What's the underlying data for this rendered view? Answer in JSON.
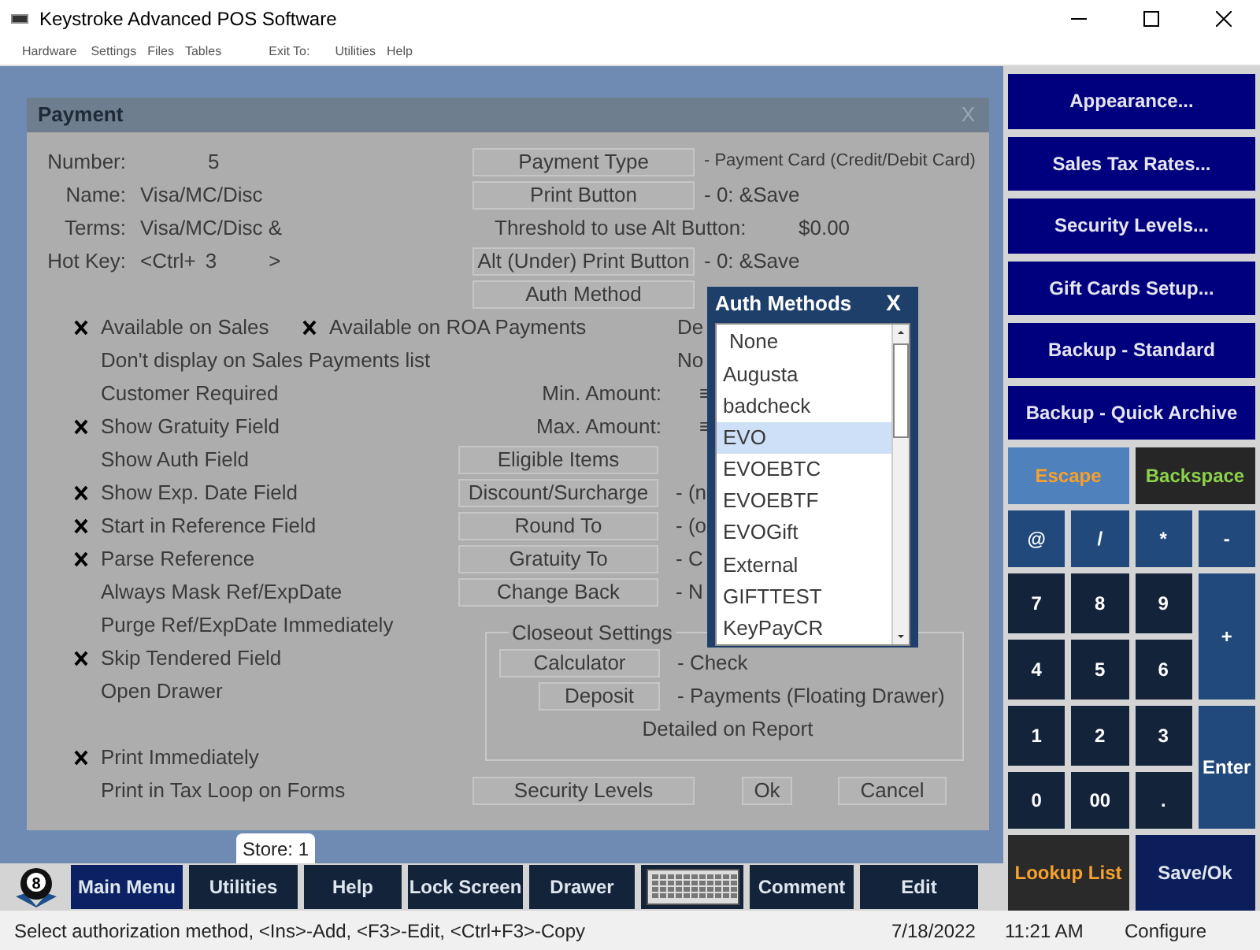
{
  "window": {
    "title": "Keystroke Advanced POS Software"
  },
  "menu": [
    {
      "label": "Hardware"
    },
    {
      "label": "Settings"
    },
    {
      "label": "Files"
    },
    {
      "label": "Tables"
    },
    {
      "label": "Exit To:"
    },
    {
      "label": "Utilities"
    },
    {
      "label": "Help"
    }
  ],
  "dialog": {
    "title": "Payment",
    "close": "X",
    "fields": [
      {
        "label": "Number:",
        "value": "5"
      },
      {
        "label": "Name:",
        "value": "Visa/MC/Disc"
      },
      {
        "label": "Terms:",
        "value": "Visa/MC/Disc &"
      },
      {
        "label": "Hot Key:",
        "value": "<Ctrl+",
        "key": "3",
        "suffix": ">"
      }
    ],
    "top_buttons": [
      {
        "button": "Payment Type",
        "value": "- Payment Card (Credit/Debit Card)"
      },
      {
        "button": "Print Button",
        "value": "- 0: &Save"
      },
      {
        "label": "Threshold to use Alt Button:",
        "value": "$0.00"
      },
      {
        "button": "Alt (Under) Print Button",
        "value": "- 0: &Save"
      },
      {
        "button": "Auth Method"
      }
    ],
    "options": [
      {
        "label": "Available on Sales",
        "checked": true
      },
      {
        "label": "Don't display on Sales Payments list",
        "checked": false
      },
      {
        "label": "Customer Required",
        "checked": false
      },
      {
        "label": "Show Gratuity Field",
        "checked": true
      },
      {
        "label": "Show Auth Field",
        "checked": false
      },
      {
        "label": "Show Exp. Date Field",
        "checked": true
      },
      {
        "label": "Start in Reference Field",
        "checked": true
      },
      {
        "label": "Parse Reference",
        "checked": true
      },
      {
        "label": "Always Mask Ref/ExpDate",
        "checked": false
      },
      {
        "label": "Purge Ref/ExpDate Immediately",
        "checked": false
      },
      {
        "label": "Skip Tendered Field",
        "checked": true
      },
      {
        "label": "Open Drawer",
        "checked": false
      },
      {
        "label": "Print Immediately",
        "checked": true
      },
      {
        "label": "Print in Tax Loop on Forms",
        "checked": false
      }
    ],
    "roa_option": {
      "label": "Available on ROA Payments",
      "checked": true
    },
    "cut_values": [
      "De",
      "No"
    ],
    "amounts": [
      {
        "label": "Min. Amount:",
        "value": "≡"
      },
      {
        "label": "Max. Amount:",
        "value": "≡"
      }
    ],
    "setting_buttons": [
      {
        "button": "Eligible Items"
      },
      {
        "button": "Discount/Surcharge",
        "value": "- (n"
      },
      {
        "button": "Round To",
        "value": "- (o"
      },
      {
        "button": "Gratuity To",
        "value": "- C"
      },
      {
        "button": "Change Back",
        "value": "- N"
      }
    ],
    "closeout": {
      "title": "Closeout Settings",
      "rows": [
        {
          "button": "Calculator",
          "value": "- Check"
        },
        {
          "button": "Deposit",
          "value": "- Payments  (Floating Drawer)"
        }
      ],
      "note": "Detailed on Report"
    },
    "buttons": [
      "Security Levels",
      "Ok",
      "Cancel"
    ]
  },
  "popup": {
    "title": "Auth Methods",
    "close": "X",
    "items": [
      {
        "label": "None",
        "selected": false
      },
      {
        "label": "Augusta",
        "selected": false
      },
      {
        "label": "badcheck",
        "selected": false
      },
      {
        "label": "EVO",
        "selected": true
      },
      {
        "label": "EVOEBTC",
        "selected": false
      },
      {
        "label": "EVOEBTF",
        "selected": false
      },
      {
        "label": "EVOGift",
        "selected": false
      },
      {
        "label": "External",
        "selected": false
      },
      {
        "label": "GIFTTEST",
        "selected": false
      },
      {
        "label": "KeyPayCR",
        "selected": false
      }
    ]
  },
  "store_tab": "Store: 1",
  "side_buttons": [
    "Appearance...",
    "Sales Tax Rates...",
    "Security Levels...",
    "Gift Cards Setup...",
    "Backup - Standard",
    "Backup - Quick Archive"
  ],
  "keypad": [
    {
      "label": "Escape",
      "kind": "escape"
    },
    {
      "label": "Backspace",
      "kind": "backspace"
    },
    {
      "label": "@",
      "kind": "symbol"
    },
    {
      "label": "/",
      "kind": "symbol"
    },
    {
      "label": "*",
      "kind": "symbol"
    },
    {
      "label": "-",
      "kind": "symbol"
    },
    {
      "label": "7",
      "kind": "digit"
    },
    {
      "label": "8",
      "kind": "digit"
    },
    {
      "label": "9",
      "kind": "digit"
    },
    {
      "label": "+",
      "kind": "tall"
    },
    {
      "label": "4",
      "kind": "digit"
    },
    {
      "label": "5",
      "kind": "digit"
    },
    {
      "label": "6",
      "kind": "digit"
    },
    {
      "label": "1",
      "kind": "digit"
    },
    {
      "label": "2",
      "kind": "digit"
    },
    {
      "label": "3",
      "kind": "digit"
    },
    {
      "label": "Enter",
      "kind": "tall"
    },
    {
      "label": "0",
      "kind": "digit"
    },
    {
      "label": "00",
      "kind": "digit"
    },
    {
      "label": ".",
      "kind": "digit"
    },
    {
      "label": "Lookup List",
      "kind": "lookup"
    },
    {
      "label": "Save/Ok",
      "kind": "save"
    }
  ],
  "logo": {
    "text": "8"
  },
  "bottom_buttons": [
    {
      "label": "Main Menu",
      "selected": true,
      "kind": "text"
    },
    {
      "label": "Utilities",
      "selected": false,
      "kind": "text"
    },
    {
      "label": "Help",
      "selected": false,
      "kind": "text"
    },
    {
      "label": "Lock Screen",
      "selected": false,
      "kind": "text"
    },
    {
      "label": "Drawer",
      "selected": false,
      "kind": "text"
    },
    {
      "kind": "keyboard",
      "selected": false
    },
    {
      "label": "Comment",
      "selected": false,
      "kind": "text"
    },
    {
      "label": "Edit",
      "selected": false,
      "kind": "text"
    }
  ],
  "status_bar": {
    "message": "Select authorization method, <Ins>-Add, <F3>-Edit, <Ctrl+F3>-Copy",
    "date": "7/18/2022",
    "time": "11:21 AM",
    "mode": "Configure"
  }
}
